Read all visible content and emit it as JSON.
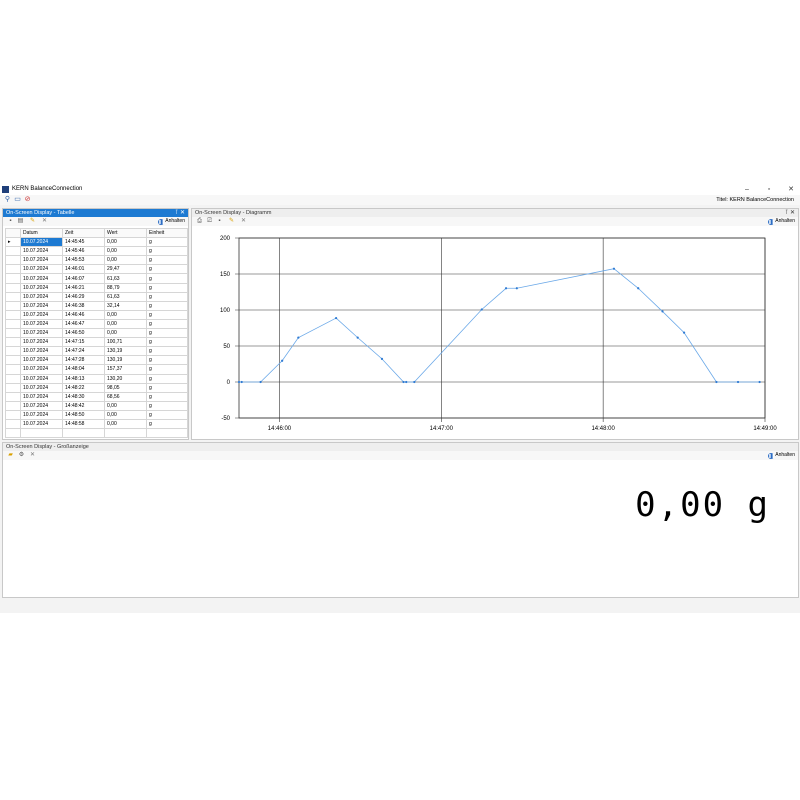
{
  "window": {
    "title": "KERN BalanceConnection",
    "titel_label": "Titel:",
    "titel_value": "KERN BalanceConnection"
  },
  "toolbar_icons": [
    "plug-icon",
    "window-icon",
    "stop-icon"
  ],
  "table_panel": {
    "title": "On-Screen Display - Tabelle",
    "anhalten": "Anhalten",
    "columns": [
      "Datum",
      "Zeit",
      "Wert",
      "Einheit"
    ],
    "rows": [
      [
        "10.07.2024",
        "14:45:45",
        "0,00",
        "g"
      ],
      [
        "10.07.2024",
        "14:45:46",
        "0,00",
        "g"
      ],
      [
        "10.07.2024",
        "14:45:53",
        "0,00",
        "g"
      ],
      [
        "10.07.2024",
        "14:46:01",
        "29,47",
        "g"
      ],
      [
        "10.07.2024",
        "14:46:07",
        "61,63",
        "g"
      ],
      [
        "10.07.2024",
        "14:46:21",
        "88,79",
        "g"
      ],
      [
        "10.07.2024",
        "14:46:29",
        "61,63",
        "g"
      ],
      [
        "10.07.2024",
        "14:46:38",
        "32,14",
        "g"
      ],
      [
        "10.07.2024",
        "14:46:46",
        "0,00",
        "g"
      ],
      [
        "10.07.2024",
        "14:46:47",
        "0,00",
        "g"
      ],
      [
        "10.07.2024",
        "14:46:50",
        "0,00",
        "g"
      ],
      [
        "10.07.2024",
        "14:47:15",
        "100,71",
        "g"
      ],
      [
        "10.07.2024",
        "14:47:24",
        "130,19",
        "g"
      ],
      [
        "10.07.2024",
        "14:47:28",
        "130,19",
        "g"
      ],
      [
        "10.07.2024",
        "14:48:04",
        "157,37",
        "g"
      ],
      [
        "10.07.2024",
        "14:48:13",
        "130,20",
        "g"
      ],
      [
        "10.07.2024",
        "14:48:22",
        "98,05",
        "g"
      ],
      [
        "10.07.2024",
        "14:48:30",
        "68,56",
        "g"
      ],
      [
        "10.07.2024",
        "14:48:42",
        "0,00",
        "g"
      ],
      [
        "10.07.2024",
        "14:48:50",
        "0,00",
        "g"
      ],
      [
        "10.07.2024",
        "14:48:58",
        "0,00",
        "g"
      ]
    ]
  },
  "diagram_panel": {
    "title": "On-Screen Display - Diagramm",
    "anhalten": "Anhalten"
  },
  "gross_panel": {
    "title": "On-Screen Display - Großanzeige",
    "anhalten": "Anhalten",
    "display_value": "0,00 g"
  },
  "chart_data": {
    "type": "line",
    "x": [
      "14:45:45",
      "14:45:46",
      "14:45:53",
      "14:46:01",
      "14:46:07",
      "14:46:21",
      "14:46:29",
      "14:46:38",
      "14:46:46",
      "14:46:47",
      "14:46:50",
      "14:47:15",
      "14:47:24",
      "14:47:28",
      "14:48:04",
      "14:48:13",
      "14:48:22",
      "14:48:30",
      "14:48:42",
      "14:48:50",
      "14:48:58"
    ],
    "values": [
      0,
      0,
      0,
      29.47,
      61.63,
      88.79,
      61.63,
      32.14,
      0,
      0,
      0,
      100.71,
      130.19,
      130.19,
      157.37,
      130.2,
      98.05,
      68.56,
      0,
      0,
      0
    ],
    "xlim": [
      "14:45:45",
      "14:49:00"
    ],
    "xticks": [
      "14:46:00",
      "14:47:00",
      "14:48:00",
      "14:49:00"
    ],
    "ylim": [
      -50,
      200
    ],
    "yticks": [
      "200",
      "150",
      "100",
      "50",
      "0",
      "-50"
    ],
    "grid": true,
    "line_color": "#6aa8e8",
    "point_color": "#2f7bd3"
  }
}
